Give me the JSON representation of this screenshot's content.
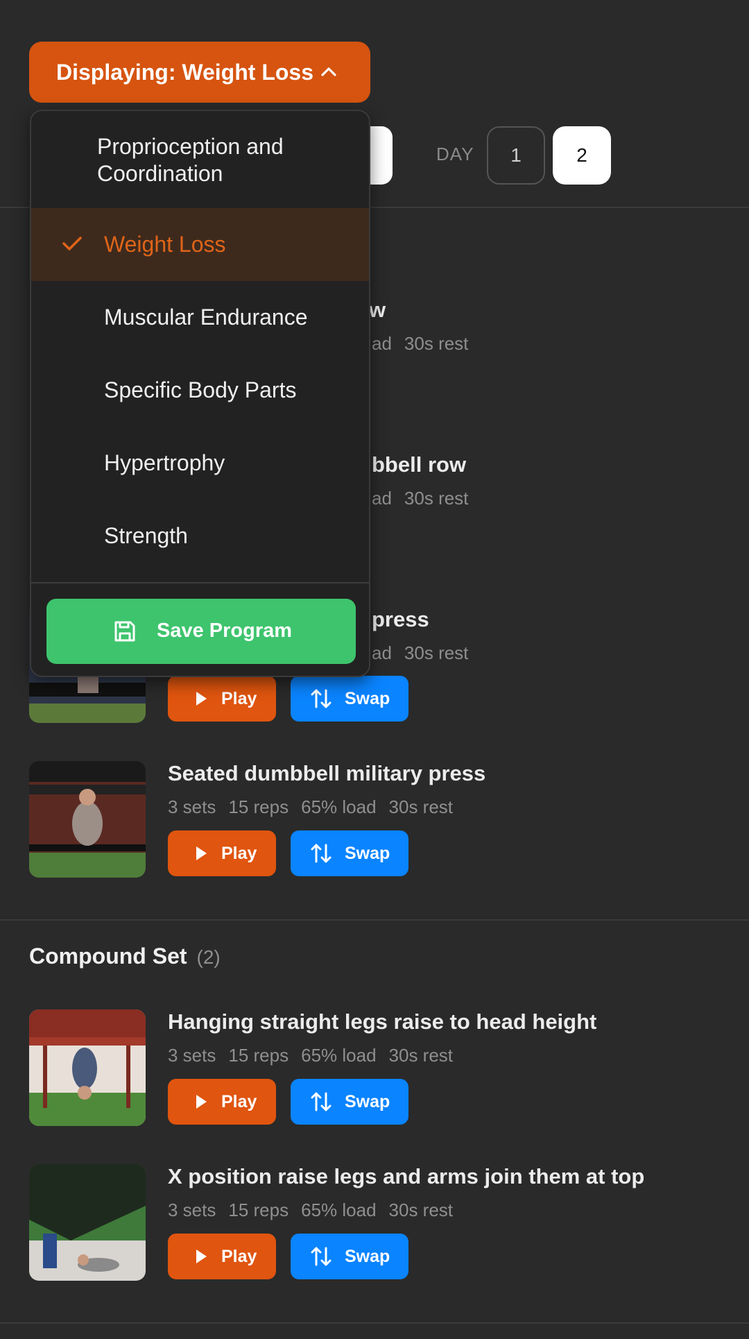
{
  "program": {
    "button_label": "Displaying: Weight Loss",
    "chevron_icon": "chevron-up-icon"
  },
  "day_selector": {
    "label": "DAY",
    "days": [
      "1",
      "2"
    ],
    "active_day": "2"
  },
  "dropdown": {
    "options": [
      {
        "label": "Proprioception and Coordination",
        "selected": false
      },
      {
        "label": "Weight Loss",
        "selected": true
      },
      {
        "label": "Muscular Endurance",
        "selected": false
      },
      {
        "label": "Specific Body Parts",
        "selected": false
      },
      {
        "label": "Hypertrophy",
        "selected": false
      },
      {
        "label": "Strength",
        "selected": false
      }
    ],
    "save_label": "Save Program",
    "save_icon": "floppy-disk-icon",
    "check_icon": "checkmark-icon"
  },
  "partial_exercises": [
    {
      "name_tail": "w",
      "stats_tail": "ad",
      "rest": "30s rest"
    },
    {
      "name_tail": "bbell row",
      "stats_tail": "ad",
      "rest": "30s rest"
    },
    {
      "name_tail": "press",
      "stats_tail": "ad",
      "rest": "30s rest"
    }
  ],
  "exercises": [
    {
      "name": "Seated dumbbell military press",
      "sets": "3 sets",
      "reps": "15 reps",
      "load": "65% load",
      "rest": "30s rest"
    },
    {
      "name": "Hanging straight legs raise to head height",
      "sets": "3 sets",
      "reps": "15 reps",
      "load": "65% load",
      "rest": "30s rest"
    },
    {
      "name": "X position raise legs and arms join them at top",
      "sets": "3 sets",
      "reps": "15 reps",
      "load": "65% load",
      "rest": "30s rest"
    }
  ],
  "sections": [
    {
      "title": "Compound Set",
      "count": "(2)"
    }
  ],
  "buttons": {
    "play_label": "Play",
    "swap_label": "Swap",
    "play_icon": "play-icon",
    "swap_icon": "swap-arrows-icon"
  },
  "colors": {
    "background": "#2a2a2a",
    "accent_orange": "#d65410",
    "swap_blue": "#0a84ff",
    "save_green": "#3ec46d",
    "selected_bg": "#3e2a1c"
  }
}
